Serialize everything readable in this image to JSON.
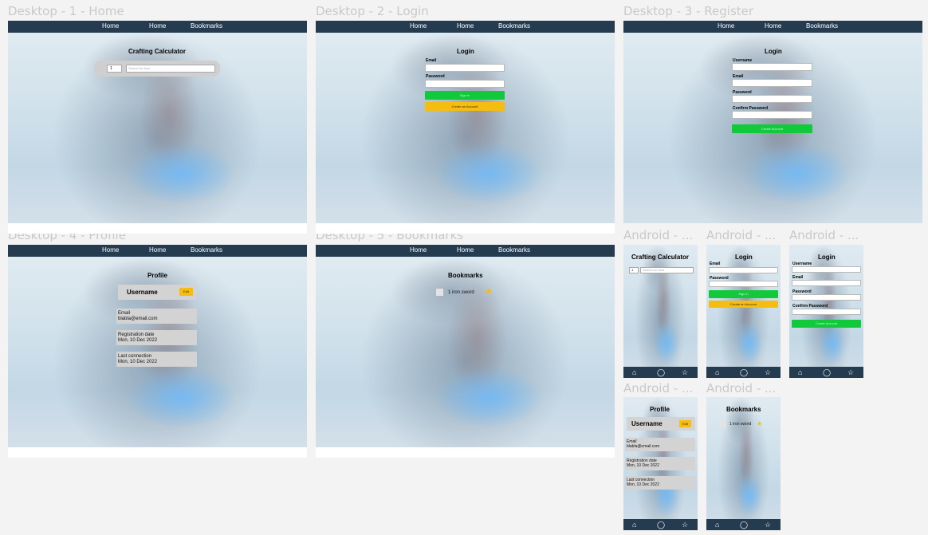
{
  "frames": {
    "d1": {
      "label": "Desktop - 1 - Home"
    },
    "d2": {
      "label": "Desktop - 2 - Login"
    },
    "d3": {
      "label": "Desktop - 3 - Register"
    },
    "d4": {
      "label": "Desktop - 4 - Profile"
    },
    "d5": {
      "label": "Desktop - 5 - Bookmarks"
    },
    "a1": {
      "label": "Android - ..."
    },
    "a2": {
      "label": "Android - ..."
    },
    "a3": {
      "label": "Android - ..."
    },
    "a4": {
      "label": "Android - ..."
    },
    "a5": {
      "label": "Android - ..."
    }
  },
  "nav": {
    "home1": "Home",
    "home2": "Home",
    "bookmarks": "Bookmarks"
  },
  "mobile_nav": {
    "home_icon": "home-icon",
    "profile_icon": "circle-icon",
    "bookmarks_icon": "star-icon"
  },
  "home": {
    "title": "Crafting Calculator",
    "quantity": "1",
    "search_placeholder": "Search for item"
  },
  "login": {
    "title": "Login",
    "email_label": "Email",
    "password_label": "Password",
    "sign_in": "Sign in",
    "create_account": "Create an Account"
  },
  "register": {
    "title": "Login",
    "username_label": "Username",
    "email_label": "Email",
    "password_label": "Password",
    "confirm_label": "Confirm Password",
    "create_account": "Create Account"
  },
  "profile": {
    "title": "Profile",
    "username": "Username",
    "edit": "Edit",
    "email_label": "Email",
    "email": "blabla@email.com",
    "reg_label": "Registration date",
    "reg_date": "Mon, 10 Dec 2022",
    "last_label": "Last connection",
    "last_date": "Mon, 10 Dec 2022"
  },
  "bookmarks": {
    "title": "Bookmarks",
    "item": "1 iron sword",
    "star": "★"
  },
  "colors": {
    "nav": "#243b50",
    "green": "#11c93a",
    "yellow": "#f5bd12",
    "star": "#f5bd12",
    "card": "#d3d3d3"
  }
}
